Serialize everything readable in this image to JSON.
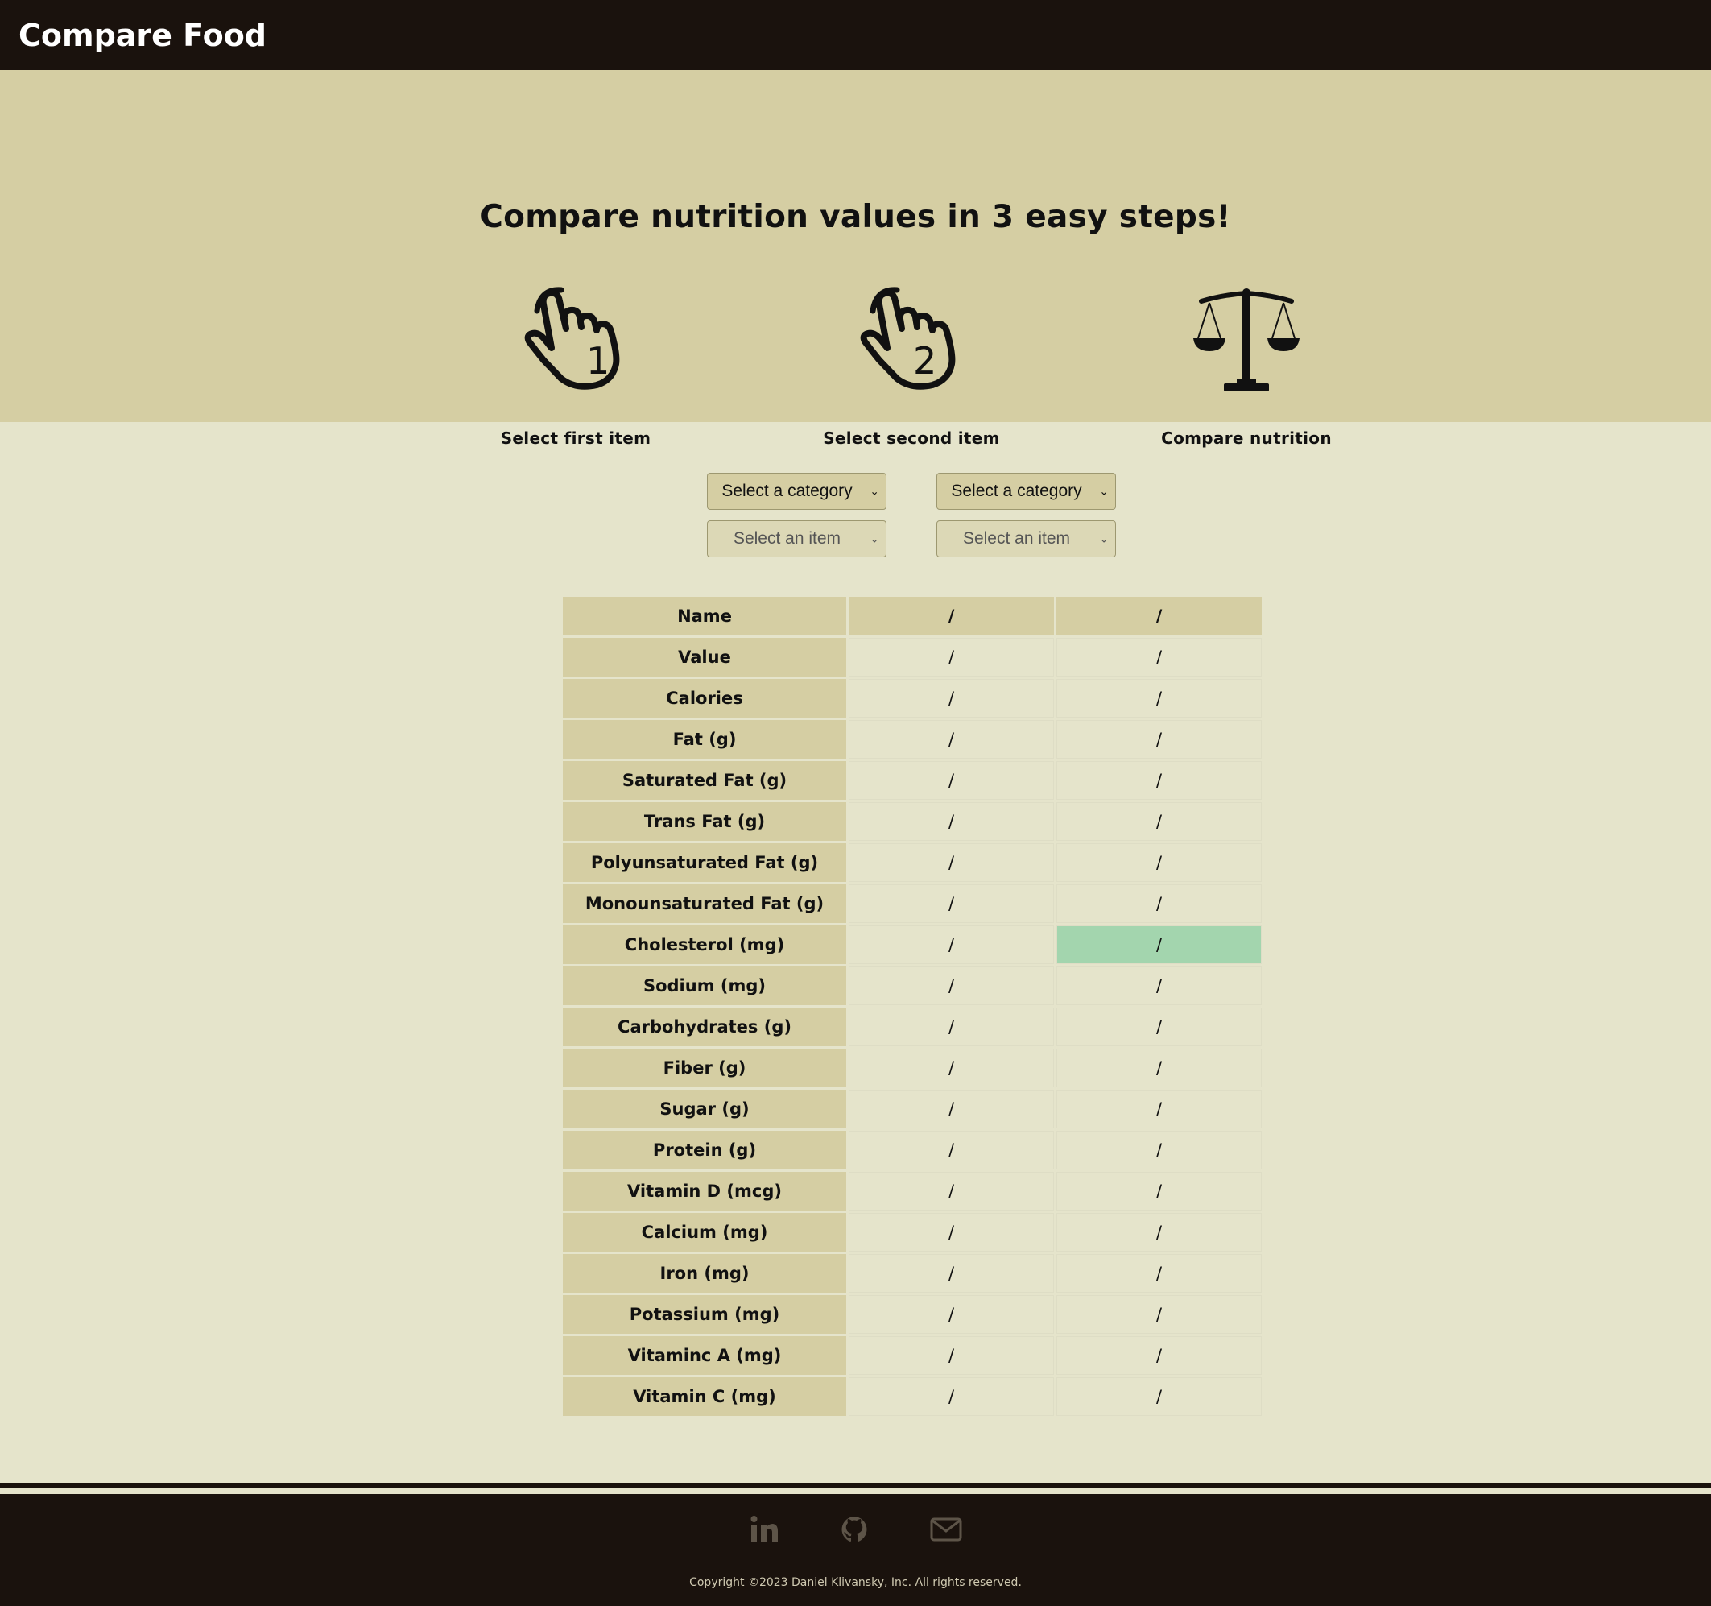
{
  "brand": "Compare Food",
  "hero": {
    "title": "Compare nutrition values in 3 easy steps!",
    "steps": [
      {
        "label": "Select first item",
        "icon": "hand-pointer-1-icon"
      },
      {
        "label": "Select second item",
        "icon": "hand-pointer-2-icon"
      },
      {
        "label": "Compare nutrition",
        "icon": "scales-icon"
      }
    ]
  },
  "selects": {
    "first_category": "Select a category",
    "second_category": "Select a category",
    "first_item": "Select an item",
    "second_item": "Select an item"
  },
  "table": {
    "header": {
      "label": "Name",
      "col1": "/",
      "col2": "/"
    },
    "rows": [
      {
        "label": "Value",
        "v1": "/",
        "v2": "/"
      },
      {
        "label": "Calories",
        "v1": "/",
        "v2": "/"
      },
      {
        "label": "Fat (g)",
        "v1": "/",
        "v2": "/"
      },
      {
        "label": "Saturated Fat (g)",
        "v1": "/",
        "v2": "/"
      },
      {
        "label": "Trans Fat (g)",
        "v1": "/",
        "v2": "/"
      },
      {
        "label": "Polyunsaturated Fat (g)",
        "v1": "/",
        "v2": "/"
      },
      {
        "label": "Monounsaturated Fat (g)",
        "v1": "/",
        "v2": "/"
      },
      {
        "label": "Cholesterol (mg)",
        "v1": "/",
        "v2": "/"
      },
      {
        "label": "Sodium (mg)",
        "v1": "/",
        "v2": "/"
      },
      {
        "label": "Carbohydrates (g)",
        "v1": "/",
        "v2": "/"
      },
      {
        "label": "Fiber (g)",
        "v1": "/",
        "v2": "/"
      },
      {
        "label": "Sugar (g)",
        "v1": "/",
        "v2": "/"
      },
      {
        "label": "Protein (g)",
        "v1": "/",
        "v2": "/"
      },
      {
        "label": "Vitamin D (mcg)",
        "v1": "/",
        "v2": "/"
      },
      {
        "label": "Calcium (mg)",
        "v1": "/",
        "v2": "/"
      },
      {
        "label": "Iron (mg)",
        "v1": "/",
        "v2": "/"
      },
      {
        "label": "Potassium (mg)",
        "v1": "/",
        "v2": "/"
      },
      {
        "label": "Vitaminc A (mg)",
        "v1": "/",
        "v2": "/"
      },
      {
        "label": "Vitamin C (mg)",
        "v1": "/",
        "v2": "/"
      }
    ],
    "highlight_color": "#a3d5ae"
  },
  "footer": {
    "icons": [
      "linkedin-icon",
      "github-icon",
      "mail-icon"
    ],
    "copyright": "Copyright ©2023 Daniel Klivansky, Inc. All rights reserved."
  },
  "colors": {
    "navbar": "#1a120d",
    "hero": "#d5cea3",
    "page": "#e5e4cb"
  }
}
